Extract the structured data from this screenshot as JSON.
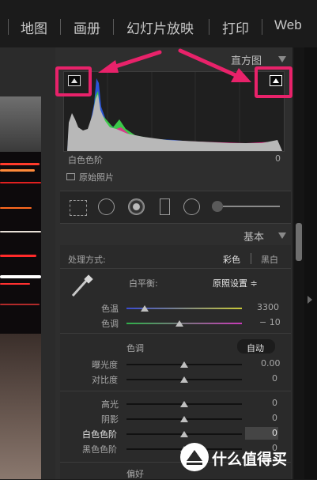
{
  "top_nav": {
    "items": [
      "地图",
      "画册",
      "幻灯片放映",
      "打印",
      "Web"
    ]
  },
  "histogram": {
    "title": "直方图",
    "label": "白色色阶",
    "value": "0",
    "original_photo": "原始照片"
  },
  "basic": {
    "title": "基本",
    "treatment_label": "处理方式:",
    "treatment_color": "彩色",
    "treatment_bw": "黑白",
    "wb_label": "白平衡:",
    "wb_value": "原照设置 ≑",
    "temp_label": "色温",
    "temp_value": "3300",
    "temp_level": 0.16,
    "tint_label": "色调",
    "tint_value": "− 10",
    "tint_level": 0.46,
    "tone_label": "色调",
    "auto_label": "自动",
    "exposure_label": "曝光度",
    "exposure_value": "0.00",
    "contrast_label": "对比度",
    "contrast_value": "0",
    "highlights_label": "高光",
    "highlights_value": "0",
    "shadows_label": "阴影",
    "shadows_value": "0",
    "whites_label": "白色色阶",
    "whites_value": "0",
    "blacks_label": "黑色色阶",
    "blacks_value": "0",
    "presence_label": "偏好"
  },
  "watermark": {
    "text": "什么值得买"
  },
  "colors": {
    "callout": "#e8226a",
    "panel": "#2e2e2e"
  }
}
